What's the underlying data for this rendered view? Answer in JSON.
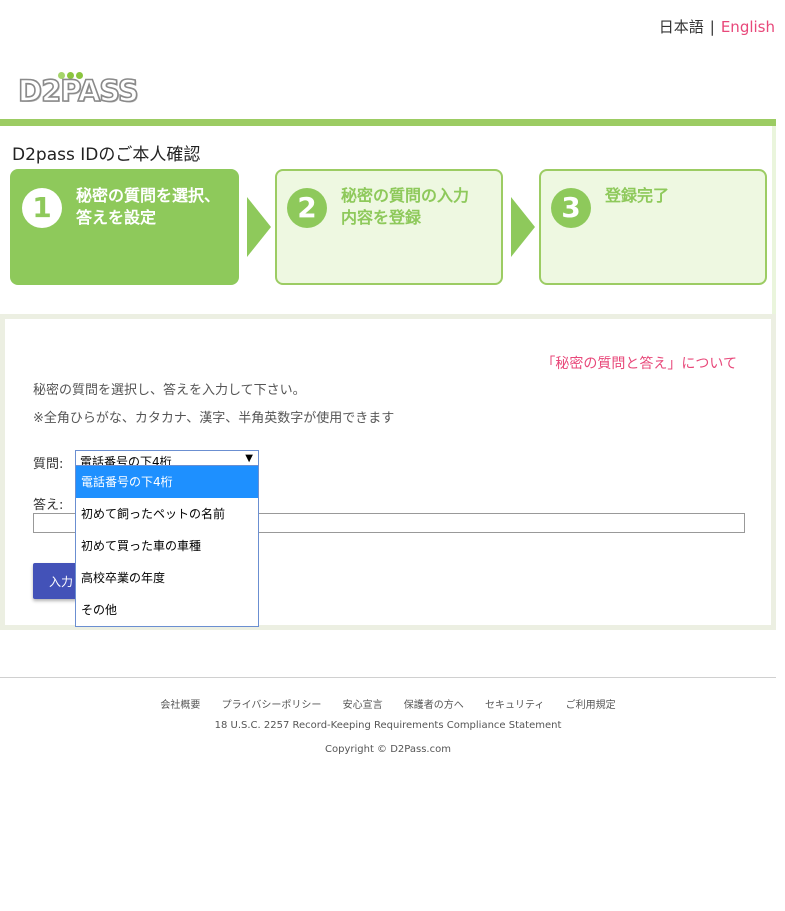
{
  "language": {
    "japanese": "日本語",
    "separator": "|",
    "english": "English"
  },
  "logo": {
    "text": "D2PASS"
  },
  "page_title": "D2pass IDのご本人確認",
  "steps": [
    {
      "number": "1",
      "line1": "秘密の質問を選択、",
      "line2": "答えを設定"
    },
    {
      "number": "2",
      "line1": "秘密の質問の入力",
      "line2": "内容を登録"
    },
    {
      "number": "3",
      "line1": "登録完了",
      "line2": ""
    }
  ],
  "form": {
    "about_link": "「秘密の質問と答え」について",
    "instruction1": "秘密の質問を選択し、答えを入力して下さい。",
    "instruction2": "※全角ひらがな、カタカナ、漢字、半角英数字が使用できます",
    "question_label": "質問:",
    "selected_question": "電話番号の下4桁",
    "answer_label": "答え:",
    "answer_value": "",
    "submit_label": "入力"
  },
  "dropdown": {
    "options": [
      "電話番号の下4桁",
      "初めて飼ったペットの名前",
      "初めて買った車の車種",
      "高校卒業の年度",
      "その他"
    ],
    "selected_index": 0
  },
  "footer": {
    "links": [
      "会社概要",
      "プライバシーポリシー",
      "安心宣言",
      "保護者の方へ",
      "セキュリティ",
      "ご利用規定"
    ],
    "compliance": "18 U.S.C. 2257 Record-Keeping Requirements Compliance Statement",
    "copyright": "Copyright © D2Pass.com"
  },
  "colors": {
    "accent_green": "#8ec95b",
    "link_pink": "#e8487a",
    "button_blue": "#4352b8",
    "selection_blue": "#1e90ff"
  }
}
